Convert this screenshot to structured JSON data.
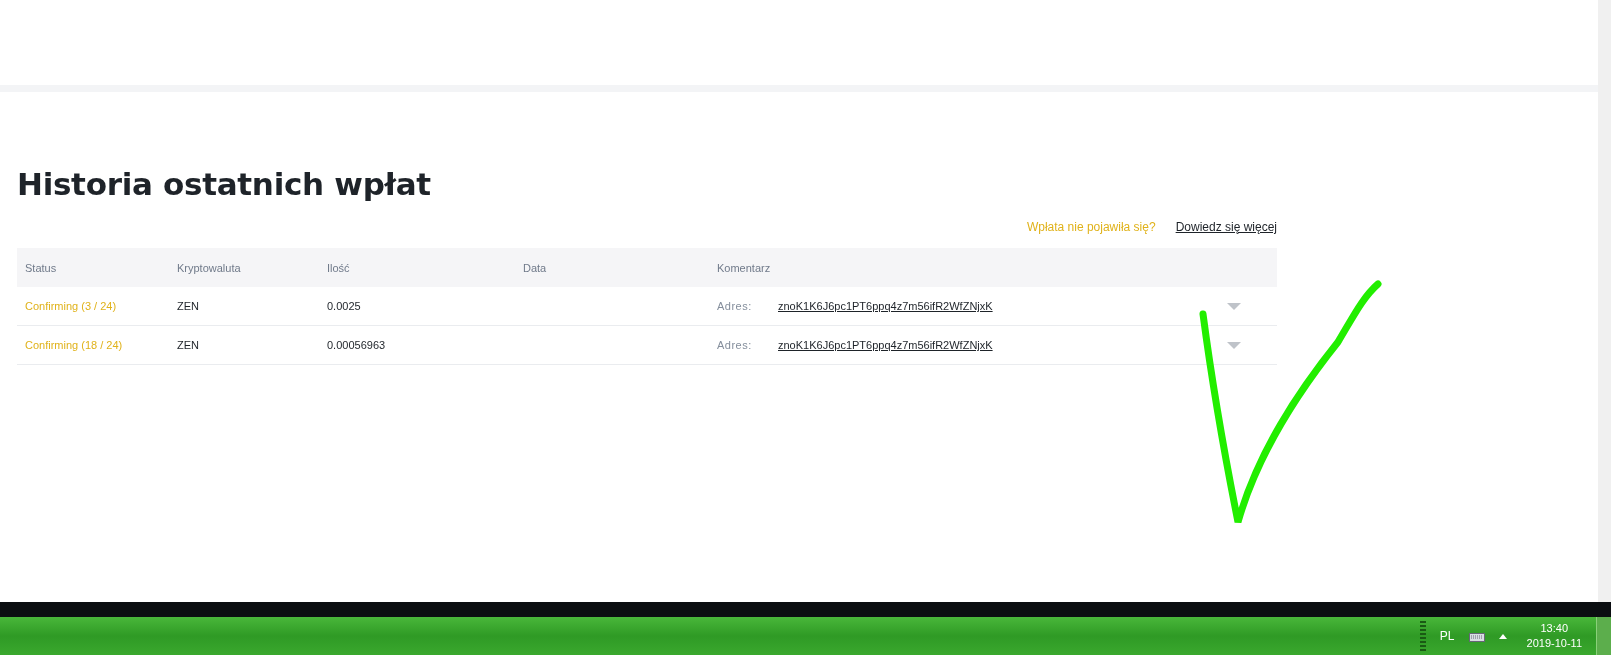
{
  "heading": "Historia ostatnich wpłat",
  "help": {
    "question": "Wpłata nie pojawiła się?",
    "link": "Dowiedz się więcej"
  },
  "table": {
    "columns": [
      "Status",
      "Kryptowaluta",
      "Ilość",
      "Data",
      "Komentarz"
    ],
    "rows": [
      {
        "status": "Confirming (3 / 24)",
        "currency": "ZEN",
        "amount": "0.0025",
        "address_label": "Adres:",
        "address": "znoK1K6J6pc1PT6ppq4z7m56ifR2WfZNjxK",
        "expanded": false
      },
      {
        "status": "Confirming (18 / 24)",
        "currency": "ZEN",
        "amount": "0.00056963",
        "address_label": "Adres:",
        "address": "znoK1K6J6pc1PT6ppq4z7m56ifR2WfZNjxK",
        "expanded": false
      }
    ]
  },
  "taskbar": {
    "language": "PL",
    "time": "13:40",
    "date": "2019-10-11"
  }
}
